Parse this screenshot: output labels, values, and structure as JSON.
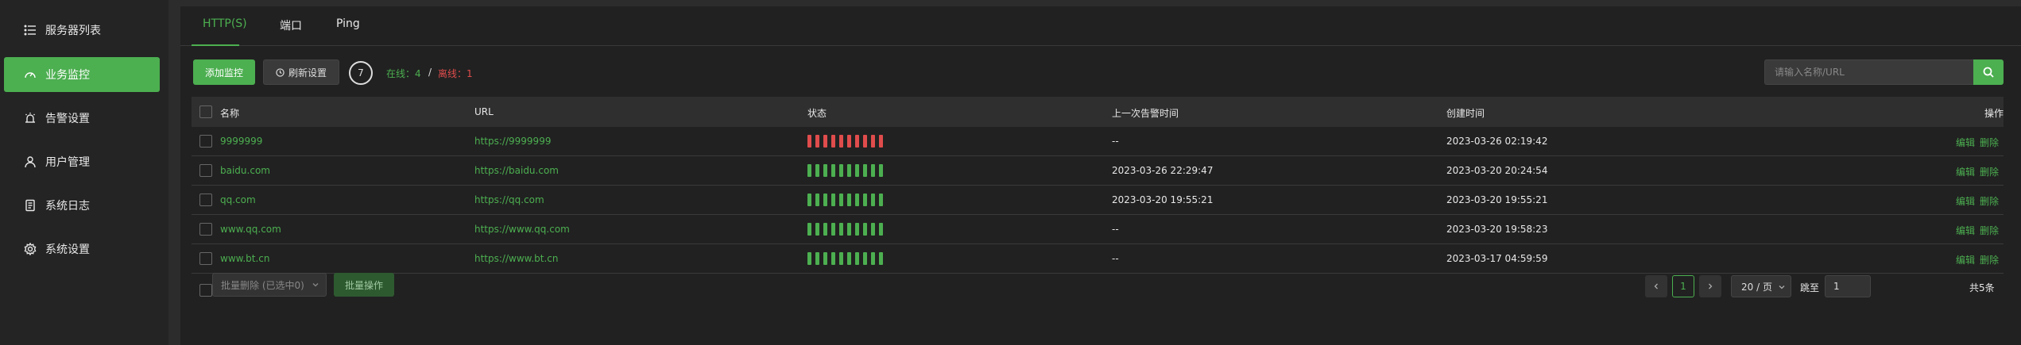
{
  "colors": {
    "accent": "#4caf50",
    "danger": "#e04c4c",
    "sidebar_bg": "#242424",
    "main_bg": "#212121"
  },
  "sidebar": {
    "items": [
      {
        "label": "服务器列表",
        "icon": "list-icon",
        "active": false
      },
      {
        "label": "业务监控",
        "icon": "dashboard-icon",
        "active": true
      },
      {
        "label": "告警设置",
        "icon": "alarm-icon",
        "active": false
      },
      {
        "label": "用户管理",
        "icon": "user-icon",
        "active": false
      },
      {
        "label": "系统日志",
        "icon": "log-icon",
        "active": false
      },
      {
        "label": "系统设置",
        "icon": "gear-icon",
        "active": false
      }
    ]
  },
  "tabs": [
    {
      "label": "HTTP(S)",
      "active": true
    },
    {
      "label": "端口",
      "active": false
    },
    {
      "label": "Ping",
      "active": false
    }
  ],
  "toolbar": {
    "add_label": "添加监控",
    "refresh_label": "刷新设置",
    "refresh_countdown": "7",
    "online_text": "在线：4",
    "separator": "/",
    "offline_text": "离线：1",
    "search_placeholder": "请输入名称/URL"
  },
  "table": {
    "headers": {
      "name": "名称",
      "url": "URL",
      "status": "状态",
      "last_alert": "上一次告警时间",
      "created": "创建时间",
      "actions": "操作"
    },
    "action_edit": "编辑",
    "action_delete": "删除",
    "rows": [
      {
        "name": "9999999",
        "url": "https://9999999",
        "status": "offline",
        "last_alert": "--",
        "created": "2023-03-26 02:19:42"
      },
      {
        "name": "baidu.com",
        "url": "https://baidu.com",
        "status": "online",
        "last_alert": "2023-03-26 22:29:47",
        "created": "2023-03-20 20:24:54"
      },
      {
        "name": "qq.com",
        "url": "https://qq.com",
        "status": "online",
        "last_alert": "2023-03-20 19:55:21",
        "created": "2023-03-20 19:55:21"
      },
      {
        "name": "www.qq.com",
        "url": "https://www.qq.com",
        "status": "online",
        "last_alert": "--",
        "created": "2023-03-20 19:58:23"
      },
      {
        "name": "www.bt.cn",
        "url": "https://www.bt.cn",
        "status": "online",
        "last_alert": "--",
        "created": "2023-03-17 04:59:59"
      }
    ],
    "status_bar_count": 10
  },
  "footer": {
    "batch_select_label": "批量删除 (已选中0)",
    "batch_action_label": "批量操作",
    "current_page": "1",
    "page_size": "20 / 页",
    "goto_label": "跳至",
    "goto_value": "1",
    "total_label": "共5条"
  }
}
